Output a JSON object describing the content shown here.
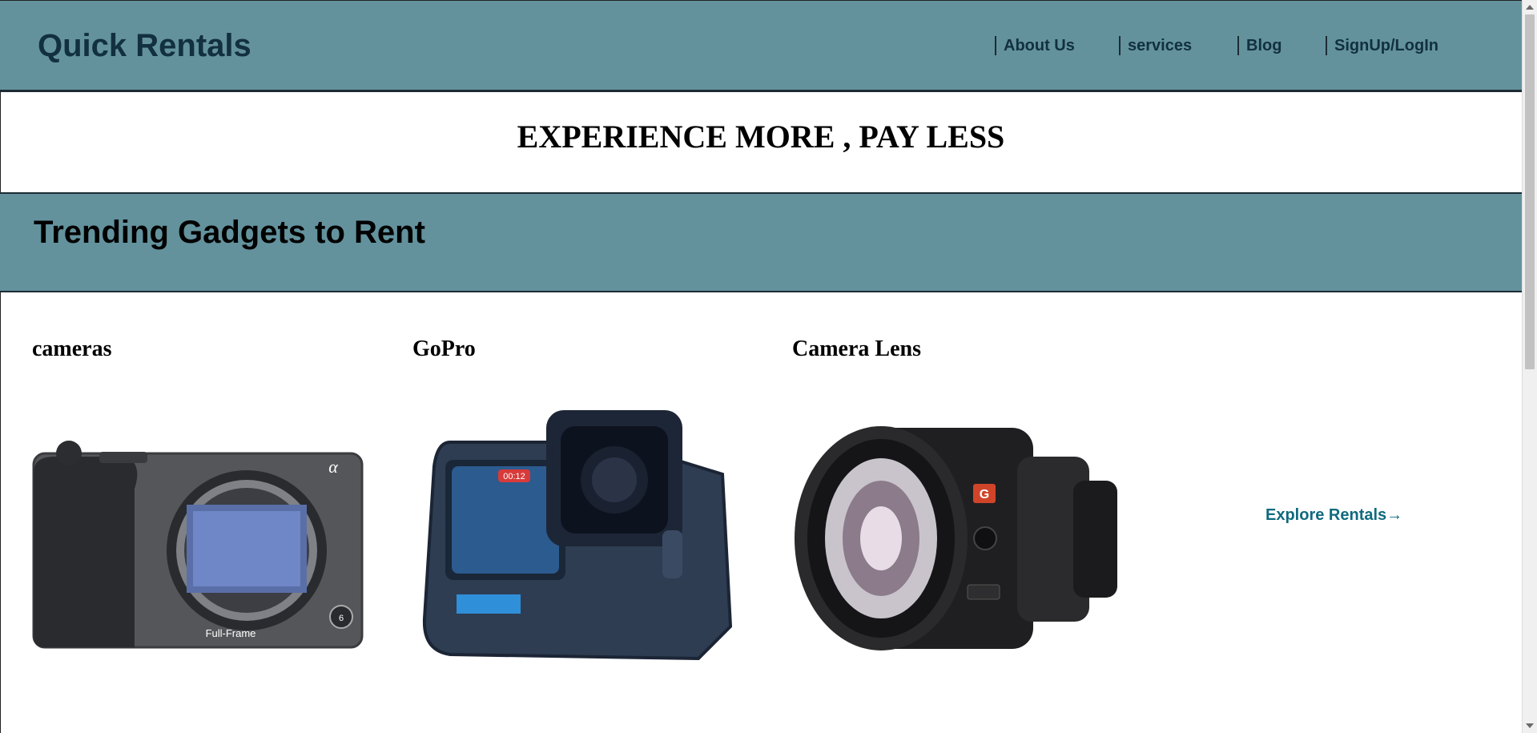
{
  "header": {
    "brand": "Quick Rentals",
    "nav": [
      {
        "label": "About Us"
      },
      {
        "label": "services"
      },
      {
        "label": "Blog"
      },
      {
        "label": "SignUp/LogIn"
      }
    ]
  },
  "hero": {
    "tagline": "EXPERIENCE MORE , PAY LESS"
  },
  "trending": {
    "title": "Trending Gadgets to Rent"
  },
  "products": [
    {
      "title": "cameras",
      "image_icon": "mirrorless-camera-icon",
      "image_text": "Full-Frame"
    },
    {
      "title": "GoPro",
      "image_icon": "gopro-action-camera-icon",
      "image_text": "00:12"
    },
    {
      "title": "Camera Lens",
      "image_icon": "camera-lens-icon",
      "image_text": "G"
    }
  ],
  "explore": {
    "label": "Explore Rentals→"
  },
  "colors": {
    "band": "#63929d",
    "dark": "#12303f",
    "link": "#0f6a7e"
  }
}
